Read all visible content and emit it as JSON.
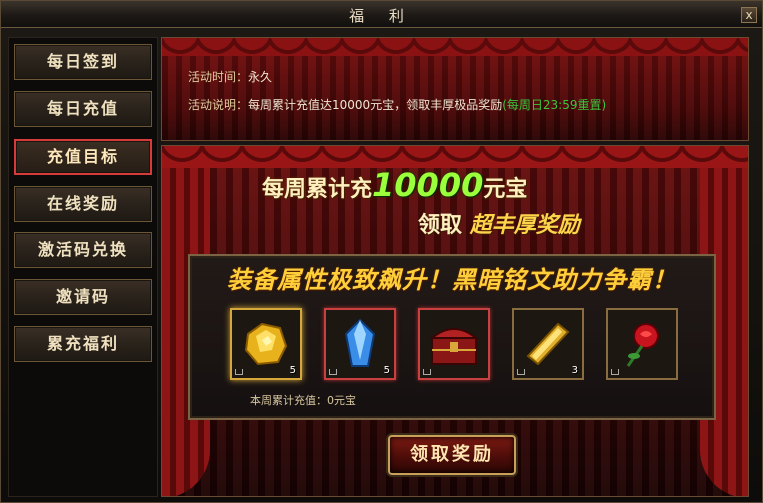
{
  "window": {
    "title": "福  利",
    "close_label": "x"
  },
  "sidebar": {
    "items": [
      {
        "label": "每日签到",
        "active": false
      },
      {
        "label": "每日充值",
        "active": false
      },
      {
        "label": "充值目标",
        "active": true
      },
      {
        "label": "在线奖励",
        "active": false
      },
      {
        "label": "激活码兑换",
        "active": false
      },
      {
        "label": "邀请码",
        "active": false
      },
      {
        "label": "累充福利",
        "active": false
      }
    ]
  },
  "info": {
    "time_label": "活动时间：",
    "time_value": "永久",
    "desc_label": "活动说明：",
    "desc_value": "每周累计充值达10000元宝，领取丰厚极品奖励",
    "desc_note": "(每周日23:59重置)"
  },
  "stage": {
    "headline1_prefix": "每周累计充",
    "headline1_number": "10000",
    "headline1_suffix": "元宝",
    "headline2_prefix": "领取",
    "headline2_highlight": "超丰厚奖励",
    "banner": "装备属性极致飙升！黑暗铭文助力争霸！",
    "weekly_label": "本周累计充值：",
    "weekly_value": "0元宝",
    "claim_button": "领取奖励"
  },
  "rewards": [
    {
      "icon": "gold-ore-icon",
      "count": "5",
      "highlight": "gold"
    },
    {
      "icon": "blue-crystal-icon",
      "count": "5",
      "highlight": "red"
    },
    {
      "icon": "treasure-chest-icon",
      "count": "",
      "highlight": "red"
    },
    {
      "icon": "gold-bar-icon",
      "count": "3",
      "highlight": "none"
    },
    {
      "icon": "red-rose-icon",
      "count": "",
      "highlight": "none"
    }
  ],
  "colors": {
    "accent_red": "#d63a3a",
    "headline_green": "#9cff3c",
    "banner_gold": "#ffcf3a",
    "note_green": "#3ec43e"
  }
}
